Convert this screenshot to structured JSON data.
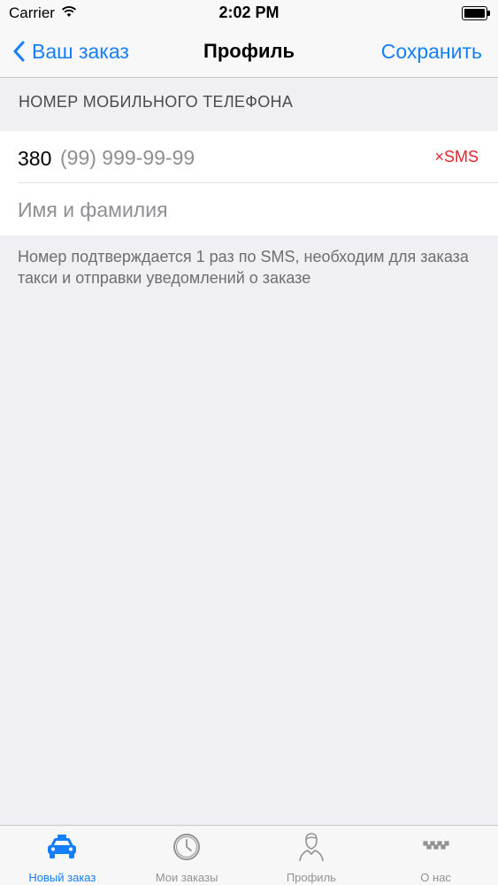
{
  "status_bar": {
    "carrier": "Carrier",
    "time": "2:02 PM",
    "wifi_icon": "wifi-icon",
    "battery_icon": "battery-full-icon"
  },
  "nav": {
    "back_label": "Ваш заказ",
    "title": "Профиль",
    "save_label": "Сохранить"
  },
  "phone_section": {
    "header": "НОМЕР МОБИЛЬНОГО ТЕЛЕФОНА",
    "prefix": "380",
    "placeholder": "(99) 999-99-99",
    "sms_status": "×SMS",
    "sms_color": "#e0262b"
  },
  "name_field": {
    "placeholder": "Имя и фамилия"
  },
  "footer_note": "Номер подтверждается 1 раз по SMS, необходим для заказа такси и отправки уведомлений о заказе",
  "tabs": [
    {
      "label": "Новый заказ",
      "icon": "taxi-car-icon",
      "active": true
    },
    {
      "label": "Мои заказы",
      "icon": "clock-icon",
      "active": false
    },
    {
      "label": "Профиль",
      "icon": "person-icon",
      "active": false
    },
    {
      "label": "О нас",
      "icon": "taxi-checker-icon",
      "active": false
    }
  ],
  "colors": {
    "accent": "#157efb",
    "background": "#efeff4",
    "inactive_tab": "#929292"
  }
}
